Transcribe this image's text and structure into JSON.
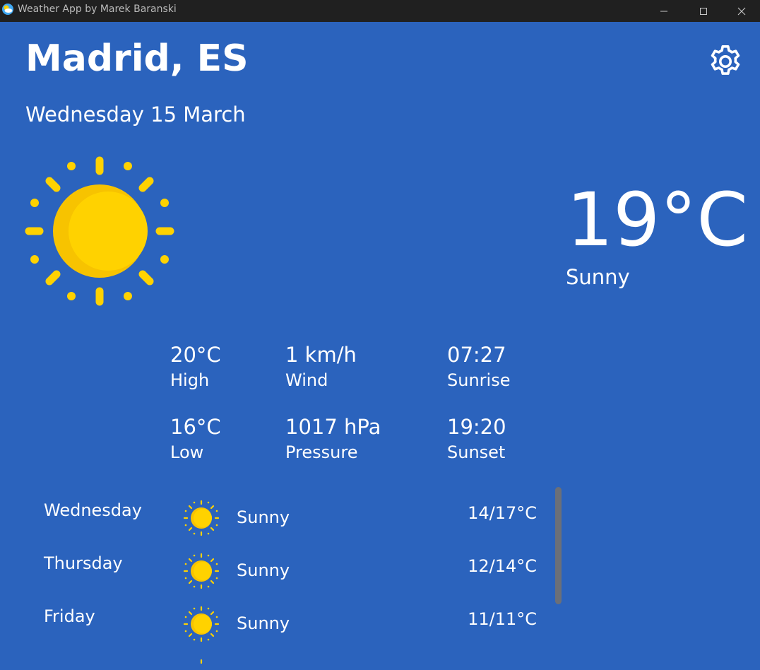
{
  "window": {
    "title": "Weather App by Marek Baranski"
  },
  "header": {
    "city": "Madrid, ES",
    "date": "Wednesday 15 March"
  },
  "current": {
    "temperature": "19°C",
    "condition": "Sunny",
    "icon": "sun-icon"
  },
  "details": [
    {
      "value": "20°C",
      "label": "High"
    },
    {
      "value": "1 km/h",
      "label": "Wind"
    },
    {
      "value": "07:27",
      "label": "Sunrise"
    },
    {
      "value": "16°C",
      "label": "Low"
    },
    {
      "value": "1017 hPa",
      "label": "Pressure"
    },
    {
      "value": "19:20",
      "label": "Sunset"
    }
  ],
  "forecast": [
    {
      "day": "Wednesday",
      "condition": "Sunny",
      "range": "14/17°C",
      "icon": "sun-icon"
    },
    {
      "day": "Thursday",
      "condition": "Sunny",
      "range": "12/14°C",
      "icon": "sun-icon"
    },
    {
      "day": "Friday",
      "condition": "Sunny",
      "range": "11/11°C",
      "icon": "sun-icon"
    }
  ],
  "colors": {
    "background": "#2b63bd",
    "titlebar": "#202020",
    "sun": "#ffd200",
    "sun_shade": "#f7c300"
  }
}
